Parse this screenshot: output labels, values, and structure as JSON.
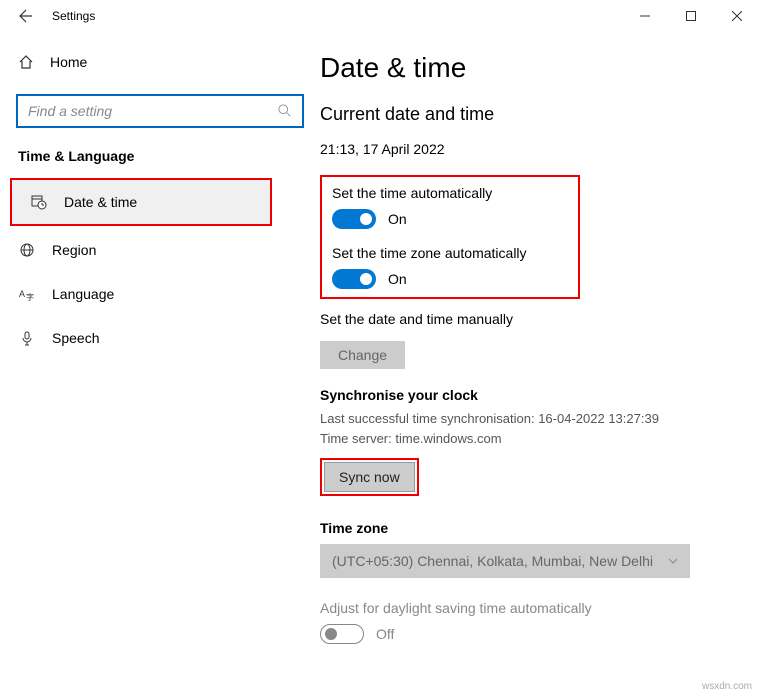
{
  "titlebar": {
    "title": "Settings"
  },
  "sidebar": {
    "home": "Home",
    "search_placeholder": "Find a setting",
    "section": "Time & Language",
    "items": [
      {
        "label": "Date & time"
      },
      {
        "label": "Region"
      },
      {
        "label": "Language"
      },
      {
        "label": "Speech"
      }
    ]
  },
  "content": {
    "title": "Date & time",
    "subtitle": "Current date and time",
    "datetime": "21:13, 17 April 2022",
    "auto_time_label": "Set the time automatically",
    "auto_tz_label": "Set the time zone automatically",
    "toggle_on": "On",
    "toggle_off": "Off",
    "manual_label": "Set the date and time manually",
    "change_btn": "Change",
    "sync_heading": "Synchronise your clock",
    "sync_last": "Last successful time synchronisation: 16-04-2022 13:27:39",
    "sync_server": "Time server: time.windows.com",
    "sync_btn": "Sync now",
    "tz_heading": "Time zone",
    "tz_value": "(UTC+05:30) Chennai, Kolkata, Mumbai, New Delhi",
    "dst_label": "Adjust for daylight saving time automatically"
  },
  "watermark": "wsxdn.com"
}
